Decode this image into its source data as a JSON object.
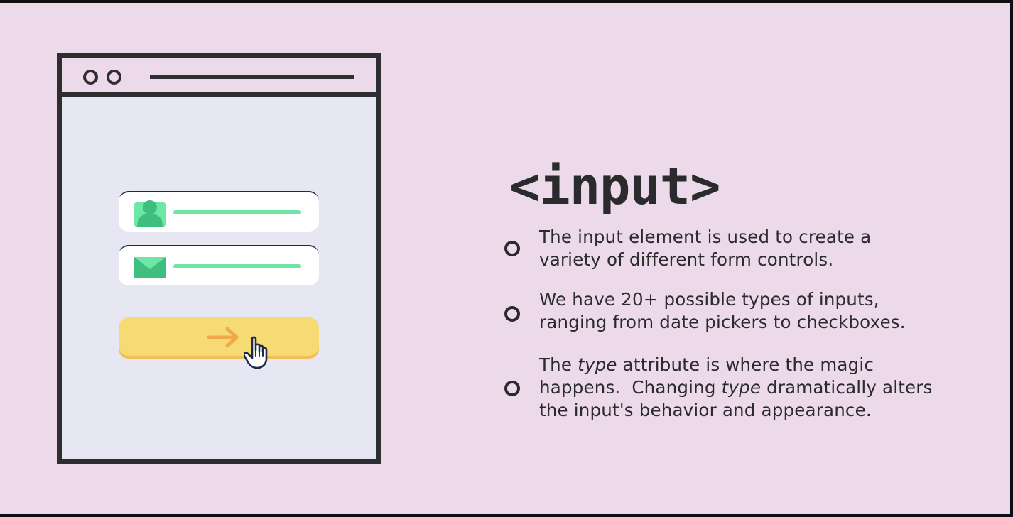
{
  "slide": {
    "title": "<input>",
    "bullets": [
      {
        "lines": [
          "The input element is used to create a",
          "variety of different form controls."
        ]
      },
      {
        "lines": [
          "We have 20+ possible types of inputs,",
          "ranging from date pickers to checkboxes."
        ]
      },
      {
        "line1_a": "The ",
        "line1_em": "type",
        "line1_b": " attribute is where the magic",
        "line2_a": "happens.  Changing ",
        "line2_em": "type",
        "line2_b": " dramatically alters",
        "line3": "the input's behavior and appearance."
      }
    ]
  },
  "illustration": {
    "icons": [
      "user-icon",
      "envelope-icon",
      "arrow-right-icon",
      "pointer-hand-icon"
    ]
  },
  "colors": {
    "background": "#ecdaea",
    "outline": "#2e2e30",
    "window_fill": "#e6e7f3",
    "field_line": "#6ee6a6",
    "icon_green": "#4fcf8c",
    "button": "#f6da73",
    "arrow": "#f0a84a"
  }
}
